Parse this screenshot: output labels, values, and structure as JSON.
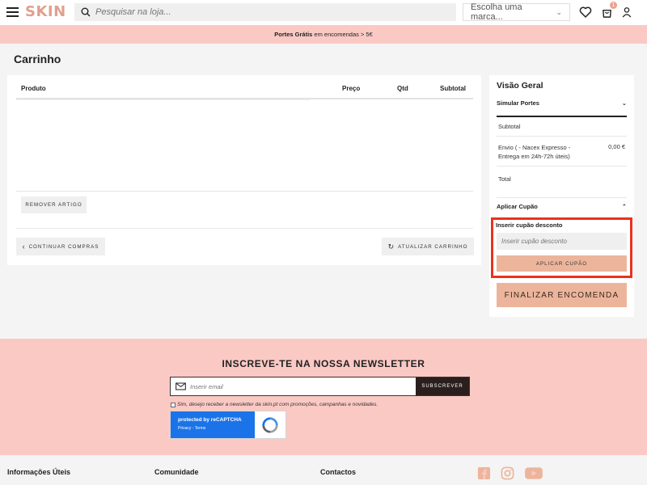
{
  "header": {
    "logo": "SKIN",
    "search_placeholder": "Pesquisar na loja...",
    "brand_select": "Escolha uma marca...",
    "cart_count": "1"
  },
  "promo": {
    "bold": "Portes Grátis",
    "text": " em encomendas > 5€"
  },
  "page_title": "Carrinho",
  "cart": {
    "columns": [
      "Produto",
      "Preço",
      "Qtd",
      "Subtotal"
    ],
    "remove_label": "REMOVER ARTIGO",
    "continue_label": "CONTINUAR COMPRAS",
    "update_label": "ATUALIZAR CARRINHO"
  },
  "summary": {
    "title": "Visão Geral",
    "simulate_shipping": "Simular Portes",
    "subtotal_label": "Subtotal",
    "shipping_label": "Envio ( - Nacex Expresso - Entrega em 24h-72h úteis)",
    "shipping_value": "0,00 €",
    "total_label": "Total",
    "apply_coupon_header": "Aplicar Cupão",
    "coupon_label": "Inserir cupão desconto",
    "coupon_placeholder": "Inserir cupão desconto",
    "coupon_button": "APLICAR CUPÃO",
    "checkout_button": "FINALIZAR ENCOMENDA"
  },
  "newsletter": {
    "title": "INSCREVE-TE NA NOSSA NEWSLETTER",
    "email_placeholder": "Inserir email",
    "subscribe_button": "SUBSCREVER",
    "consent": "Sim, desejo receber a newsletter da skin.pt com promoções, campanhas e novidades.",
    "recaptcha_title": "protected by reCAPTCHA",
    "recaptcha_links": "Privacy - Terms"
  },
  "footer": {
    "col1": "Informações Úteis",
    "col2": "Comunidade",
    "col3": "Contactos"
  },
  "colors": {
    "accent": "#ecb59b",
    "promo_bg": "#fbc9c4",
    "highlight": "#e8321f",
    "logo": "#e0a08e"
  }
}
